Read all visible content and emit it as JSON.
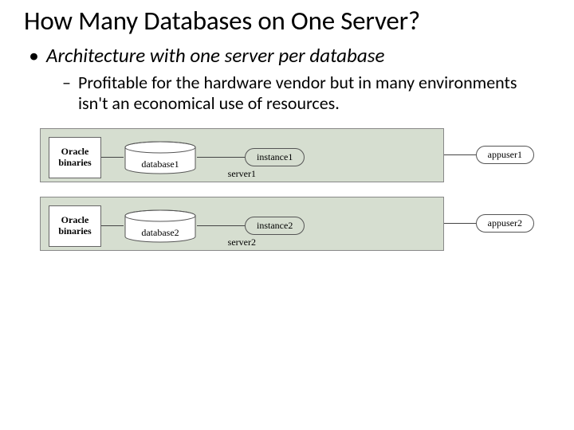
{
  "title": "How Many Databases on One Server?",
  "bullets": {
    "l1": "Architecture with one server per database",
    "l2": "Profitable for the hardware vendor but in many environments isn't an economical use of resources."
  },
  "diagram": {
    "binaries_line1": "Oracle",
    "binaries_line2": "binaries",
    "servers": [
      {
        "db": "database1",
        "instance": "instance1",
        "server": "server1",
        "appuser": "appuser1"
      },
      {
        "db": "database2",
        "instance": "instance2",
        "server": "server2",
        "appuser": "appuser2"
      }
    ]
  }
}
